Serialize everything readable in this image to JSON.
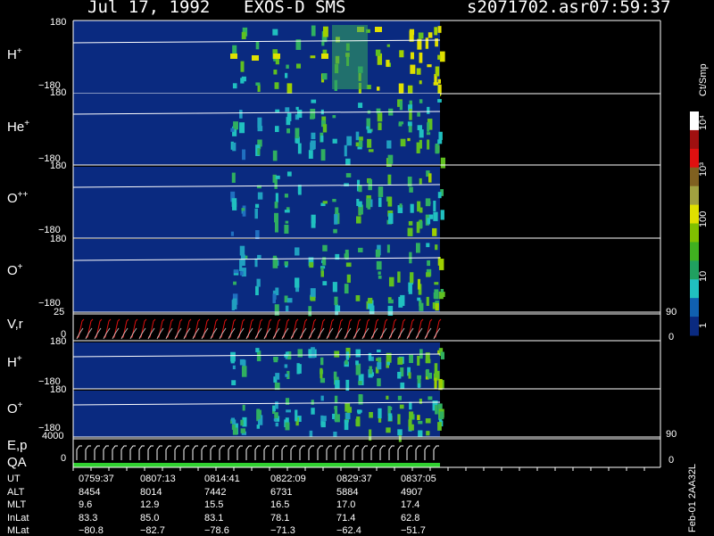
{
  "header": {
    "date": "Jul 17, 1992",
    "instrument": "EXOS-D SMS",
    "file": "s2071702.asr",
    "time": "07:59:37"
  },
  "colorbar": {
    "unit": "Ct/Smp",
    "labels": [
      "10⁴",
      "10³",
      "100",
      "10",
      "1"
    ],
    "colors": [
      "#ffffff",
      "#a01010",
      "#e01010",
      "#806020",
      "#a0a040",
      "#e0e000",
      "#80c000",
      "#40b020",
      "#20a060",
      "#20c0c0",
      "#1060b0",
      "#0a2a80"
    ]
  },
  "panels": [
    {
      "id": "h1",
      "label_main": "H",
      "label_sup": "+",
      "ytop": "180",
      "ybot": "−180"
    },
    {
      "id": "he",
      "label_main": "He",
      "label_sup": "+",
      "ytop": "180",
      "ybot": "−180"
    },
    {
      "id": "opp",
      "label_main": "O",
      "label_sup": "++",
      "ytop": "180",
      "ybot": "−180"
    },
    {
      "id": "o1",
      "label_main": "O",
      "label_sup": "+",
      "ytop": "180",
      "ybot": "−180"
    },
    {
      "id": "vr",
      "label_main": "V,r",
      "label_sup": "",
      "ytop": "25",
      "ybot": "0",
      "rtop": "90",
      "rbot": "0"
    },
    {
      "id": "h2",
      "label_main": "H",
      "label_sup": "+",
      "ytop": "180",
      "ybot": "−180"
    },
    {
      "id": "o2",
      "label_main": "O",
      "label_sup": "+",
      "ytop": "180",
      "ybot": "−180"
    },
    {
      "id": "ep",
      "label_main": "E,p",
      "label_sup": "",
      "label2": "QA",
      "ytop": "4000",
      "ybot": "0",
      "rtop": "90",
      "rbot": "0"
    }
  ],
  "ephemeris": {
    "rows": [
      {
        "name": "UT",
        "values": [
          "0759:37",
          "0807:13",
          "0814:41",
          "0822:09",
          "0829:37",
          "0837:05"
        ]
      },
      {
        "name": "ALT",
        "values": [
          "8454",
          "8014",
          "7442",
          "6731",
          "5884",
          "4907"
        ]
      },
      {
        "name": "MLT",
        "values": [
          "9.6",
          "12.9",
          "15.5",
          "16.5",
          "17.0",
          "17.4"
        ]
      },
      {
        "name": "InLat",
        "values": [
          "83.3",
          "85.0",
          "83.1",
          "78.1",
          "71.4",
          "62.8"
        ]
      },
      {
        "name": "MLat",
        "values": [
          "−80.8",
          "−82.7",
          "−78.6",
          "−71.3",
          "−62.4",
          "−51.7"
        ]
      }
    ]
  },
  "side_note": "Feb-01 2AA32L"
}
